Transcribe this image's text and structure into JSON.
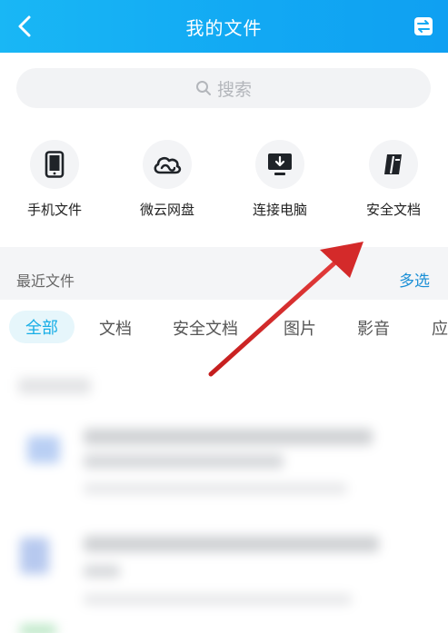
{
  "header": {
    "title": "我的文件",
    "back_icon": "chevron-left-icon",
    "switch_icon": "swap-icon"
  },
  "search": {
    "placeholder": "搜索",
    "icon": "search-icon"
  },
  "tools": [
    {
      "label": "手机文件",
      "icon": "phone-icon"
    },
    {
      "label": "微云网盘",
      "icon": "cloud-icon"
    },
    {
      "label": "连接电脑",
      "icon": "monitor-icon"
    },
    {
      "label": "安全文档",
      "icon": "secure-doc-icon"
    }
  ],
  "recent": {
    "title": "最近文件",
    "multi_select": "多选"
  },
  "tabs": [
    {
      "label": "全部",
      "active": true
    },
    {
      "label": "文档"
    },
    {
      "label": "安全文档"
    },
    {
      "label": "图片"
    },
    {
      "label": "影音"
    },
    {
      "label": "应"
    }
  ],
  "colors": {
    "header_gradient_start": "#19b7f5",
    "header_gradient_end": "#0fa0f2",
    "accent": "#17aee6",
    "link": "#1a8fd6",
    "annotation_arrow": "#d42a2a"
  }
}
